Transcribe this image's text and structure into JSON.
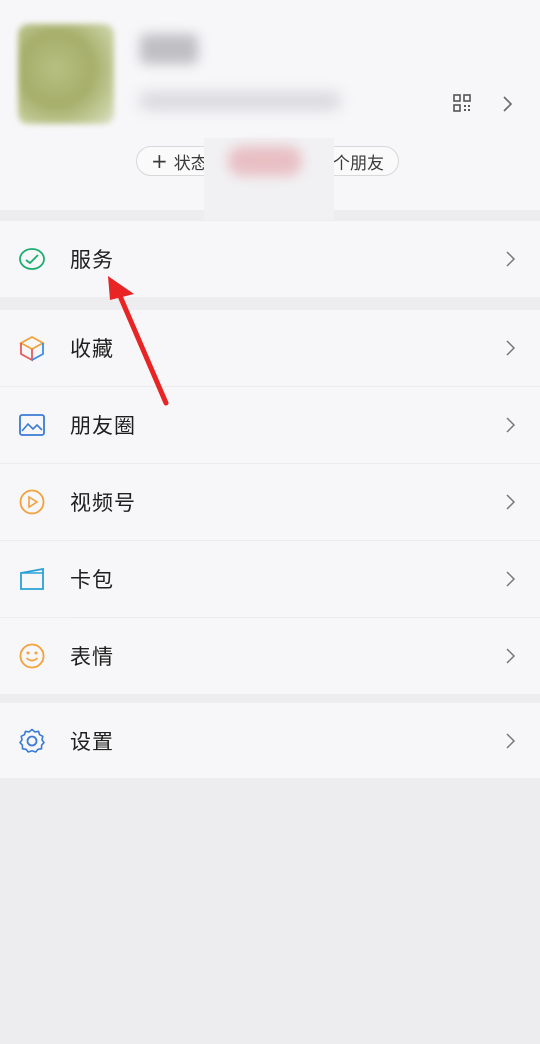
{
  "profile": {
    "status_label": "状态",
    "friends_label": "个朋友"
  },
  "menu": {
    "services": "服务",
    "favorites": "收藏",
    "moments": "朋友圈",
    "channels": "视频号",
    "cards": "卡包",
    "stickers": "表情",
    "settings": "设置"
  },
  "colors": {
    "accent_green": "#1aad6f",
    "favorites_orange": "#f0a33a",
    "favorites_blue": "#3a8ee6",
    "moments_blue": "#3a7bd5",
    "channels_orange": "#f2a13b",
    "cards_blue": "#2aa0d8",
    "stickers_orange": "#f2a13b",
    "settings_blue": "#3a7bd5",
    "annotation_red": "#e82424"
  }
}
